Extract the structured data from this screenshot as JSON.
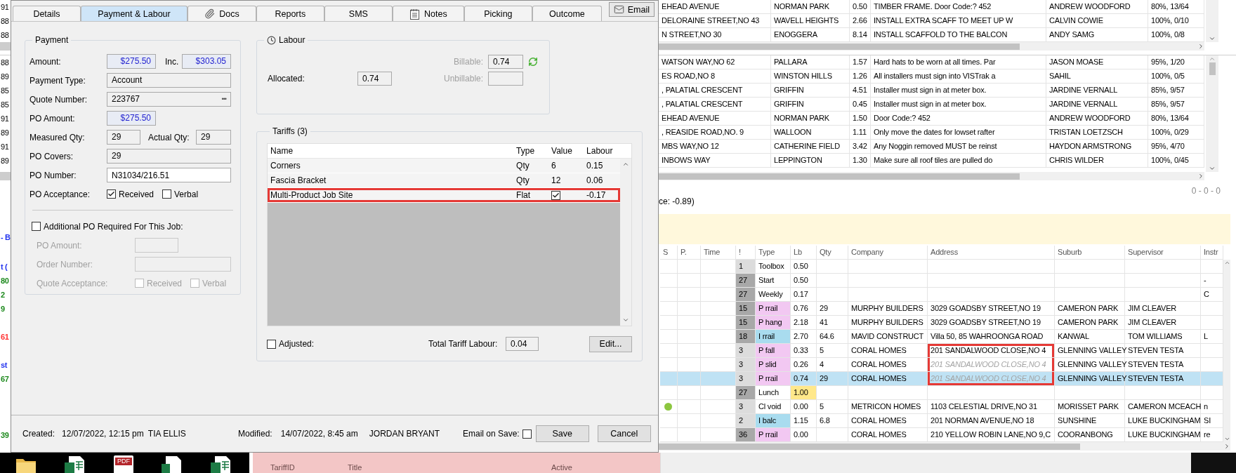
{
  "dialog": {
    "tabs": [
      {
        "label": "Details",
        "kind": "plain",
        "selected": false
      },
      {
        "label": "Payment & Labour",
        "kind": "plain",
        "selected": true
      },
      {
        "label": "Docs",
        "kind": "attachment",
        "selected": false
      },
      {
        "label": "Reports",
        "kind": "plain",
        "selected": false
      },
      {
        "label": "SMS",
        "kind": "plain",
        "selected": false
      },
      {
        "label": "Notes",
        "kind": "notes",
        "selected": false
      },
      {
        "label": "Picking",
        "kind": "plain",
        "selected": false
      },
      {
        "label": "Outcome",
        "kind": "plain",
        "selected": false
      }
    ],
    "email_button": "Email",
    "payment": {
      "title": "Payment",
      "amount": {
        "label": "Amount:",
        "value": "$275.50"
      },
      "inc": {
        "label": "Inc.",
        "value": "$303.05"
      },
      "payment_type": {
        "label": "Payment Type:",
        "value": "Account"
      },
      "quote_number": {
        "label": "Quote Number:",
        "value": "223767",
        "button": "•••"
      },
      "po_amount": {
        "label": "PO Amount:",
        "value": "$275.50"
      },
      "measured_qty": {
        "label": "Measured Qty:",
        "value": "29"
      },
      "actual_qty": {
        "label": "Actual Qty:",
        "value": "29"
      },
      "po_covers": {
        "label": "PO Covers:",
        "value": "29"
      },
      "po_number": {
        "label": "PO Number:",
        "value": "N31034/216.51"
      },
      "po_acceptance": {
        "label": "PO Acceptance:",
        "options": [
          {
            "label": "Received",
            "checked": true
          },
          {
            "label": "Verbal",
            "checked": false
          }
        ]
      },
      "additional_po": {
        "label": "Additional PO Required For This Job:",
        "checked": false,
        "disabled": true,
        "po_amount": {
          "label": "PO Amount:"
        },
        "order_number": {
          "label": "Order Number:"
        },
        "quote_acceptance": {
          "label": "Quote Acceptance:",
          "options": [
            {
              "label": "Received",
              "checked": false
            },
            {
              "label": "Verbal",
              "checked": false
            }
          ]
        }
      }
    },
    "labour": {
      "title": "Labour",
      "billable": {
        "label": "Billable:",
        "value": "0.74",
        "disabled": true
      },
      "allocated": {
        "label": "Allocated:",
        "value": "0.74"
      },
      "unbillable": {
        "label": "Unbillable:",
        "disabled": true
      }
    },
    "tariffs": {
      "title": "Tariffs (3)",
      "columns": [
        "Name",
        "Type",
        "Value",
        "Labour"
      ],
      "rows": [
        {
          "name": "Corners",
          "type": "Qty",
          "kind": "number",
          "value": "6",
          "labour": "0.15",
          "highlighted": false
        },
        {
          "name": "Fascia Bracket",
          "type": "Qty",
          "kind": "number",
          "value": "12",
          "labour": "0.06",
          "highlighted": false
        },
        {
          "name": "Multi-Product Job Site",
          "type": "Flat",
          "kind": "checkbox",
          "checked": true,
          "labour": "-0.17",
          "highlighted": true
        }
      ],
      "adjusted": {
        "label": "Adjusted:",
        "checked": false
      },
      "total": {
        "label": "Total Tariff Labour:",
        "value": "0.04"
      },
      "edit_button": "Edit..."
    },
    "footer": {
      "created_label": "Created:",
      "created_date": "12/07/2022, 12:15 pm",
      "created_by": "TIA ELLIS",
      "modified_label": "Modified:",
      "modified_date": "14/07/2022, 8:45 am",
      "modified_by": "JORDAN BRYANT",
      "email_on_save": {
        "label": "Email on Save:",
        "checked": false
      },
      "save_button": "Save",
      "cancel_button": "Cancel"
    }
  },
  "background": {
    "top_grid": {
      "rows": [
        {
          "number": "91",
          "address": "EHEAD AVENUE",
          "suburb": "NORMAN PARK",
          "lb": "0.50",
          "notes": "TIMBER FRAME. Door Code:? 452",
          "supervisor": "ANDREW WOODFORD",
          "progress": "80%, 13/64"
        },
        {
          "number": "88",
          "address": "DELORAINE STREET,NO 43",
          "suburb": "WAVELL HEIGHTS",
          "lb": "2.66",
          "notes": "INSTALL EXTRA SCAFF TO MEET UP W",
          "supervisor": "CALVIN COWIE",
          "progress": "100%, 0/10"
        },
        {
          "number": "88",
          "address": "N STREET,NO 30",
          "suburb": "ENOGGERA",
          "lb": "8.14",
          "notes": "INSTALL SCAFFOLD TO THE BALCON",
          "supervisor": "ANDY SAMG",
          "progress": "100%, 0/8"
        }
      ]
    },
    "middle_grid": {
      "rows": [
        {
          "number": "88",
          "address": "WATSON WAY,NO 62",
          "suburb": "PALLARA",
          "lb": "1.57",
          "notes": "Hard hats to be worn at all times. Par",
          "supervisor": "JASON MOASE",
          "progress": "95%, 1/20"
        },
        {
          "number": "89",
          "address": "ES ROAD,NO 8",
          "suburb": "WINSTON HILLS",
          "lb": "1.26",
          "notes": "All installers must sign into VISTrak a",
          "supervisor": "SAHIL",
          "progress": "100%, 0/5"
        },
        {
          "number": "85",
          "address": ", PALATIAL CRESCENT",
          "suburb": "GRIFFIN",
          "lb": "4.51",
          "notes": "Installer must sign in at meter box.",
          "supervisor": "JARDINE VERNALL",
          "progress": "85%, 9/57"
        },
        {
          "number": "85",
          "address": ", PALATIAL CRESCENT",
          "suburb": "GRIFFIN",
          "lb": "0.45",
          "notes": "Installer must sign in at meter box.",
          "supervisor": "JARDINE VERNALL",
          "progress": "85%, 9/57"
        },
        {
          "number": "91",
          "address": "EHEAD AVENUE",
          "suburb": "NORMAN PARK",
          "lb": "1.50",
          "notes": "Door Code:? 452",
          "supervisor": "ANDREW WOODFORD",
          "progress": "80%, 13/64"
        },
        {
          "number": "89",
          "address": ", REASIDE ROAD,NO. 9",
          "suburb": "WALLOON",
          "lb": "1.11",
          "notes": "Only move the dates for lowset rafter",
          "supervisor": "TRISTAN LOETZSCH",
          "progress": "100%, 0/29"
        },
        {
          "number": "91",
          "address": "MBS WAY,NO 12",
          "suburb": "CATHERINE FIELD",
          "lb": "3.42",
          "notes": "Any Noggin removed MUST be reinst",
          "supervisor": "HAYDON ARMSTRONG",
          "progress": "95%, 4/70"
        },
        {
          "number": "89",
          "address": "INBOWS WAY",
          "suburb": "LEPPINGTON",
          "lb": "1.30",
          "notes": "Make sure all roof tiles are pulled do",
          "supervisor": "CHRIS WILDER",
          "progress": "100%, 0/45"
        }
      ]
    },
    "status_text": "ce: -0.89)",
    "counter": "0 - 0 - 0",
    "side_note": {
      "text": "- B",
      "color": "#2233ee"
    },
    "schedule": {
      "columns": [
        "S",
        "P.",
        "Time",
        "!",
        "Type",
        "Lb",
        "Qty",
        "Company",
        "Address",
        "Suburb",
        "Supervisor",
        "Instr"
      ],
      "rows": [
        {
          "lead": {
            "text": "t (",
            "color": "#2233ee"
          },
          "flag": {
            "text": "1",
            "color": "#dcdcdc"
          },
          "type": {
            "text": "Toolbox"
          },
          "lb": {
            "text": "0.50"
          },
          "selected": false,
          "framed": false
        },
        {
          "lead": {
            "text": "80",
            "color": "#1e8a1e"
          },
          "flag": {
            "text": "27",
            "color": "#a8a8a8"
          },
          "type": {
            "text": "Start"
          },
          "lb": {
            "text": "0.50"
          },
          "instr": "-",
          "selected": false,
          "framed": false
        },
        {
          "lead": {
            "text": "2",
            "color": "#1e8a1e"
          },
          "flag": {
            "text": "27",
            "color": "#a8a8a8"
          },
          "type": {
            "text": "Weekly"
          },
          "lb": {
            "text": "0.17"
          },
          "instr": "C",
          "selected": false,
          "framed": false
        },
        {
          "lead": {
            "text": "9",
            "color": "#1e8a1e"
          },
          "flag": {
            "text": "15",
            "color": "#a8a8a8"
          },
          "type": {
            "text": "P rrail",
            "color": "#f2c8f2"
          },
          "lb": {
            "text": "0.76"
          },
          "qty": "29",
          "company": "MURPHY BUILDERS",
          "address": "3029 GOADSBY STREET,NO 19",
          "suburb": "CAMERON PARK",
          "supervisor": "JIM CLEAVER",
          "selected": false,
          "dimmed": false,
          "framed": false
        },
        {
          "flag": {
            "text": "15",
            "color": "#a8a8a8"
          },
          "type": {
            "text": "P hang",
            "color": "#f2c8f2"
          },
          "lb": {
            "text": "2.18"
          },
          "qty": "41",
          "company": "MURPHY BUILDERS",
          "address": "3029 GOADSBY STREET,NO 19",
          "suburb": "CAMERON PARK",
          "supervisor": "JIM CLEAVER",
          "selected": false,
          "dimmed": false,
          "framed": false
        },
        {
          "lead": {
            "text": "61",
            "color": "#ff3333"
          },
          "flag": {
            "text": "18",
            "color": "#a8a8a8"
          },
          "type": {
            "text": "I rrail",
            "color": "#a9dcef"
          },
          "lb": {
            "text": "2.70"
          },
          "qty": "64.6",
          "company": "MAVID CONSTRUCT",
          "address": "Villa 50, 85 WAHROONGA ROAD",
          "suburb": "KANWAL",
          "supervisor": "TOM WILLIAMS",
          "instr": "L",
          "selected": false,
          "dimmed": false,
          "framed": false
        },
        {
          "flag": {
            "text": "3",
            "color": "#dcdcdc"
          },
          "type": {
            "text": "P fall",
            "color": "#f2c8f2"
          },
          "lb": {
            "text": "0.33"
          },
          "qty": "5",
          "company": "CORAL HOMES",
          "address": "201 SANDALWOOD CLOSE,NO 4",
          "suburb": "GLENNING VALLEY",
          "supervisor": "STEVEN TESTA",
          "selected": false,
          "dimmed": false,
          "framed": true
        },
        {
          "lead": {
            "text": "st",
            "color": "#2233ee"
          },
          "flag": {
            "text": "3",
            "color": "#dcdcdc"
          },
          "type": {
            "text": "P slid",
            "color": "#f2c8f2"
          },
          "lb": {
            "text": "0.26"
          },
          "qty": "4",
          "company": "CORAL HOMES",
          "address": "201 SANDALWOOD CLOSE,NO 4",
          "suburb": "GLENNING VALLEY",
          "supervisor": "STEVEN TESTA",
          "selected": false,
          "dimmed": true,
          "framed": true
        },
        {
          "lead": {
            "text": "67",
            "color": "#1e8a1e"
          },
          "flag": {
            "text": "3",
            "color": "#dcdcdc"
          },
          "type": {
            "text": "P rrail",
            "color": "#f2c8f2"
          },
          "lb": {
            "text": "0.74"
          },
          "qty": "29",
          "company": "CORAL HOMES",
          "address": "201 SANDALWOOD CLOSE,NO 4",
          "suburb": "GLENNING VALLEY",
          "supervisor": "STEVEN TESTA",
          "selected": true,
          "dimmed": true,
          "framed": true
        },
        {
          "flag": {
            "text": "27",
            "color": "#a8a8a8"
          },
          "type": {
            "text": "Lunch"
          },
          "lb": {
            "text": "1.00",
            "color": "#ffe88a"
          },
          "selected": false,
          "framed": false
        },
        {
          "dot": {
            "color": "#8cc63f"
          },
          "flag": {
            "text": "3",
            "color": "#dcdcdc"
          },
          "type": {
            "text": "Cl void"
          },
          "lb": {
            "text": "0.00"
          },
          "qty": "5",
          "company": "METRICON HOMES",
          "address": "1103 CELESTIAL DRIVE,NO 31",
          "suburb": "MORISSET PARK",
          "supervisor": "CAMERON MCEACH",
          "instr": "n",
          "selected": false,
          "dimmed": false,
          "framed": false
        },
        {
          "flag": {
            "text": "2",
            "color": "#dcdcdc"
          },
          "type": {
            "text": "I balc",
            "color": "#a9dcef"
          },
          "lb": {
            "text": "1.15"
          },
          "qty": "6.8",
          "company": "CORAL HOMES",
          "address": "201 NORMAN AVENUE,NO 18",
          "suburb": "SUNSHINE",
          "supervisor": "LUKE BUCKINGHAM",
          "instr": "SI",
          "selected": false,
          "dimmed": false,
          "framed": false
        },
        {
          "lead": {
            "text": "39",
            "color": "#1e8a1e"
          },
          "flag": {
            "text": "36",
            "color": "#a8a8a8"
          },
          "type": {
            "text": "P rrail",
            "color": "#f2c8f2"
          },
          "lb": {
            "text": "0.00"
          },
          "company": "CORAL HOMES",
          "address": "210 YELLOW ROBIN LANE,NO 9,C",
          "suburb": "COORANBONG",
          "supervisor": "LUKE BUCKINGHAM",
          "instr": "re",
          "selected": false,
          "dimmed": false,
          "framed": false
        }
      ]
    },
    "taskbar": {
      "icons": [
        {
          "kind": "folder"
        },
        {
          "kind": "spreadsheet"
        },
        {
          "kind": "pdf",
          "label": "PDF"
        },
        {
          "kind": "document"
        },
        {
          "kind": "spreadsheet"
        }
      ],
      "panel_columns": [
        "TariffID",
        "Title",
        "Active"
      ]
    }
  }
}
